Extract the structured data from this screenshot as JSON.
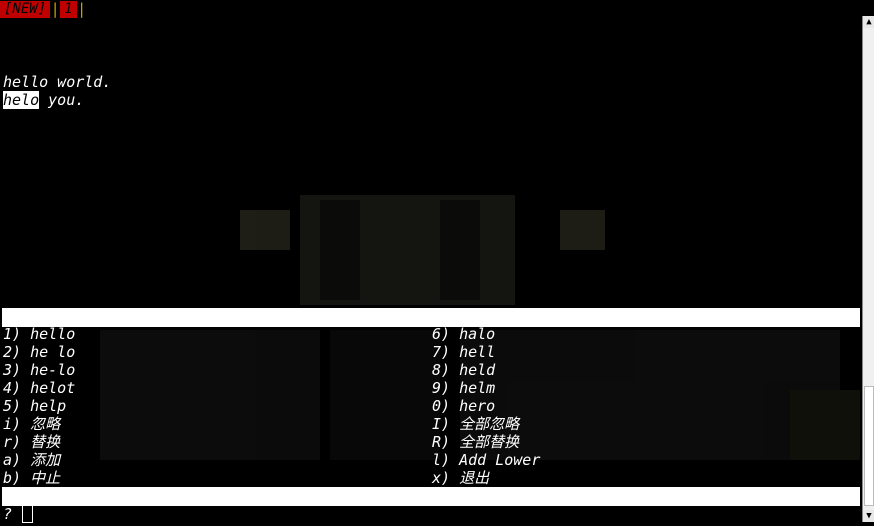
{
  "tabline": {
    "new_tab": "[NEW]",
    "tab_number": "1",
    "separator": "|"
  },
  "buffer": {
    "line1": "hello world.",
    "line2_misspelled": "helo",
    "line2_rest": " you."
  },
  "suggestions": {
    "left": [
      {
        "key": "1)",
        "word": "hello"
      },
      {
        "key": "2)",
        "word": "he lo"
      },
      {
        "key": "3)",
        "word": "he-lo"
      },
      {
        "key": "4)",
        "word": "helot"
      },
      {
        "key": "5)",
        "word": "help"
      }
    ],
    "right": [
      {
        "key": "6)",
        "word": "halo"
      },
      {
        "key": "7)",
        "word": "hell"
      },
      {
        "key": "8)",
        "word": "held"
      },
      {
        "key": "9)",
        "word": "helm"
      },
      {
        "key": "0)",
        "word": "hero"
      }
    ]
  },
  "actions": {
    "left": [
      {
        "key": "i)",
        "label": "忽略"
      },
      {
        "key": "r)",
        "label": "替换"
      },
      {
        "key": "a)",
        "label": "添加"
      },
      {
        "key": "b)",
        "label": "中止"
      }
    ],
    "right": [
      {
        "key": "I)",
        "label": "全部忽略"
      },
      {
        "key": "R)",
        "label": "全部替换"
      },
      {
        "key": "l)",
        "label": "Add Lower"
      },
      {
        "key": "x)",
        "label": "退出"
      }
    ]
  },
  "prompt": {
    "symbol": "?"
  },
  "colors": {
    "tab_bg": "#c00000",
    "separator": "#c8a000",
    "background": "#000000",
    "text": "#ffffff"
  }
}
